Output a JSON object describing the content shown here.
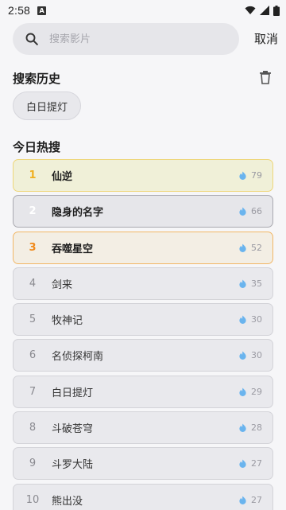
{
  "status": {
    "time": "2:58",
    "notif_glyph": "A"
  },
  "search": {
    "placeholder": "搜索影片",
    "value": "",
    "cancel_label": "取消"
  },
  "history": {
    "title": "搜索历史",
    "items": [
      "白日提灯"
    ]
  },
  "hot": {
    "title": "今日热搜",
    "items": [
      {
        "rank": "1",
        "title": "仙逆",
        "heat": "79"
      },
      {
        "rank": "2",
        "title": "隐身的名字",
        "heat": "66"
      },
      {
        "rank": "3",
        "title": "吞噬星空",
        "heat": "52"
      },
      {
        "rank": "4",
        "title": "剑来",
        "heat": "35"
      },
      {
        "rank": "5",
        "title": "牧神记",
        "heat": "30"
      },
      {
        "rank": "6",
        "title": "名侦探柯南",
        "heat": "30"
      },
      {
        "rank": "7",
        "title": "白日提灯",
        "heat": "29"
      },
      {
        "rank": "8",
        "title": "斗破苍穹",
        "heat": "28"
      },
      {
        "rank": "9",
        "title": "斗罗大陆",
        "heat": "27"
      },
      {
        "rank": "10",
        "title": "熊出没",
        "heat": "27"
      }
    ]
  },
  "icons": {
    "search": "search-icon",
    "trash": "trash-icon",
    "flame": "flame-icon",
    "wifi": "wifi-icon",
    "signal": "signal-icon",
    "battery": "battery-icon"
  },
  "colors": {
    "rank1": "#f0b020",
    "rank2": "#ffffff",
    "rank3": "#f08a1c",
    "flame": "#6ab4ee",
    "background": "#f6f6f8"
  }
}
